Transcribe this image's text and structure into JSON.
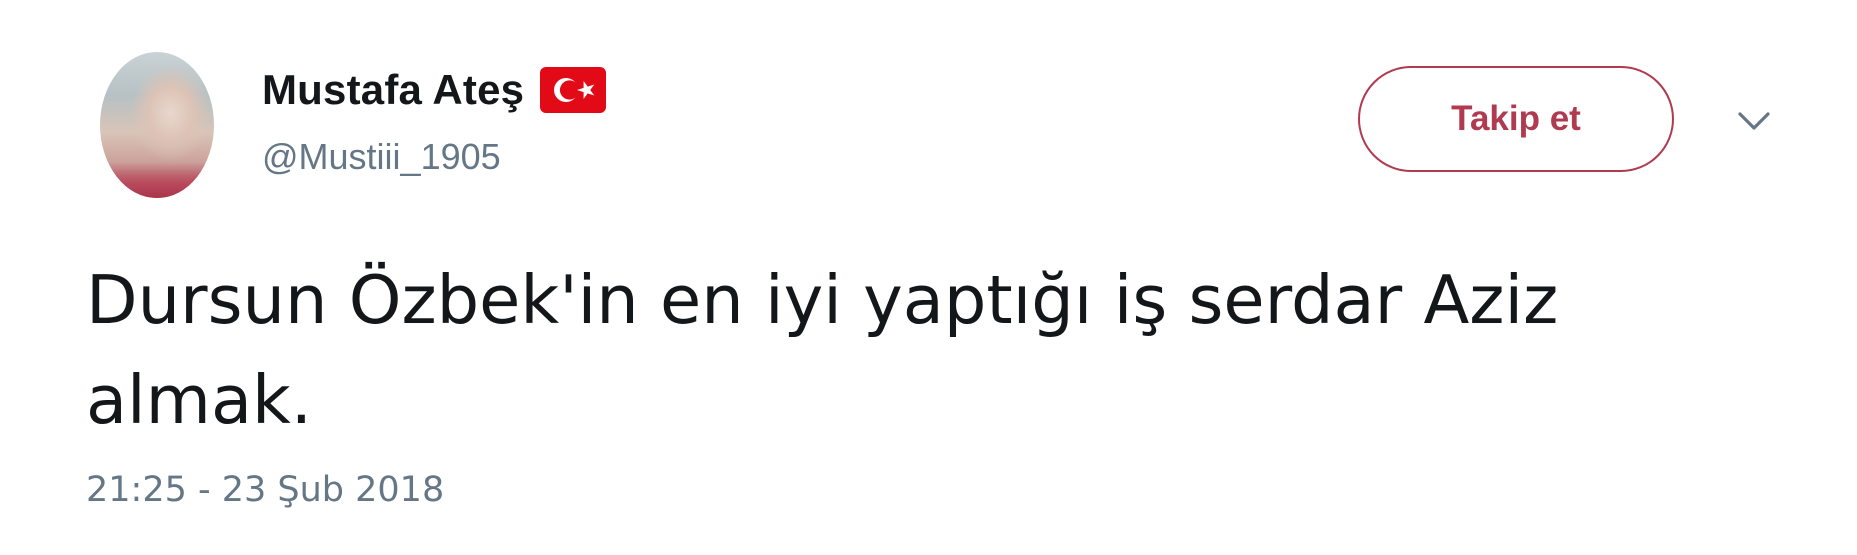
{
  "user": {
    "display_name": "Mustafa Ateş",
    "handle": "@Mustiii_1905",
    "flag_icon": "turkey-flag-icon"
  },
  "actions": {
    "follow_label": "Takip et",
    "more_icon": "chevron-down-icon"
  },
  "tweet": {
    "text": "Dursun Özbek'in en iyi yaptığı iş serdar Aziz almak.",
    "timestamp": "21:25 - 23 Şub 2018"
  },
  "colors": {
    "text": "#14171a",
    "secondary_text": "#657786",
    "follow_accent": "#b03a50",
    "flag_red": "#e30a17"
  }
}
